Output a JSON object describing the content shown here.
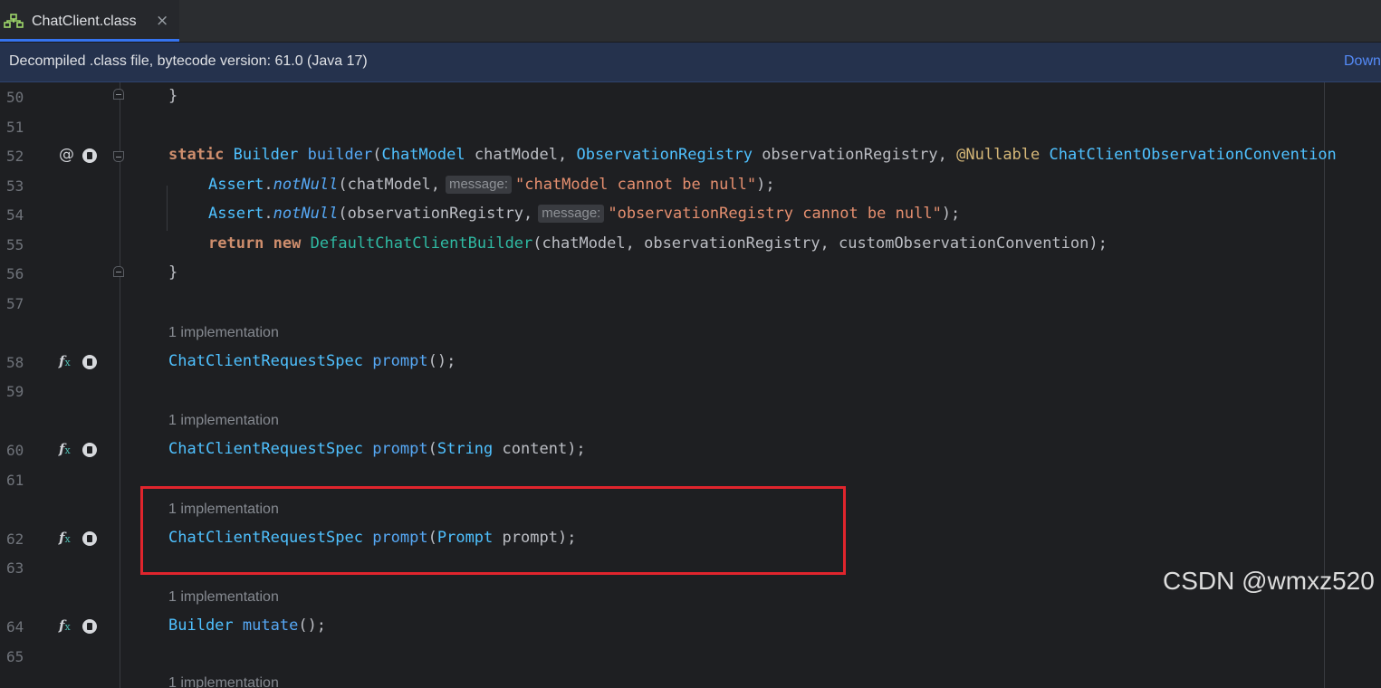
{
  "tab": {
    "title": "ChatClient.class",
    "close": "×",
    "icon": "class-file-icon"
  },
  "banner": {
    "text": "Decompiled .class file, bytecode version: 61.0 (Java 17)",
    "link": "Down"
  },
  "gutter": {
    "lines": [
      "50",
      "51",
      "52",
      "53",
      "54",
      "55",
      "56",
      "57",
      "58",
      "59",
      "60",
      "61",
      "62",
      "63",
      "64",
      "65"
    ],
    "icons": {
      "annotation": "@",
      "implement": "f",
      "implement_sub": "x"
    }
  },
  "code": {
    "l50_brace": "}",
    "l52": {
      "static": "static",
      "ret": "Builder",
      "name": "builder",
      "p1type": "ChatModel",
      "p1name": "chatModel",
      "p2type": "ObservationRegistry",
      "p2name": "observationRegistry",
      "ann": "@Nullable",
      "p3type": "ChatClientObservationConvention"
    },
    "l53": {
      "cls": "Assert",
      "meth": "notNull",
      "arg": "chatModel",
      "hint": "message:",
      "str": "\"chatModel cannot be null\""
    },
    "l54": {
      "cls": "Assert",
      "meth": "notNull",
      "arg": "observationRegistry",
      "hint": "message:",
      "str": "\"observationRegistry cannot be null\""
    },
    "l55": {
      "ret": "return",
      "new": "new",
      "cls": "DefaultChatClientBuilder",
      "args": "(chatModel, observationRegistry, customObservationConvention);"
    },
    "l56_brace": "}",
    "impl_label": "1 implementation",
    "l58": {
      "type": "ChatClientRequestSpec",
      "name": "prompt",
      "rest": "();"
    },
    "l60": {
      "type": "ChatClientRequestSpec",
      "name": "prompt",
      "ptype": "String",
      "pname": "content"
    },
    "l62": {
      "type": "ChatClientRequestSpec",
      "name": "prompt",
      "ptype": "Prompt",
      "pname": "prompt"
    },
    "l64": {
      "type": "Builder",
      "name": "mutate",
      "rest": "();"
    }
  },
  "colors": {
    "highlight_border": "#e0252d",
    "accent": "#3574f0"
  },
  "watermark": "CSDN @wmxz520"
}
